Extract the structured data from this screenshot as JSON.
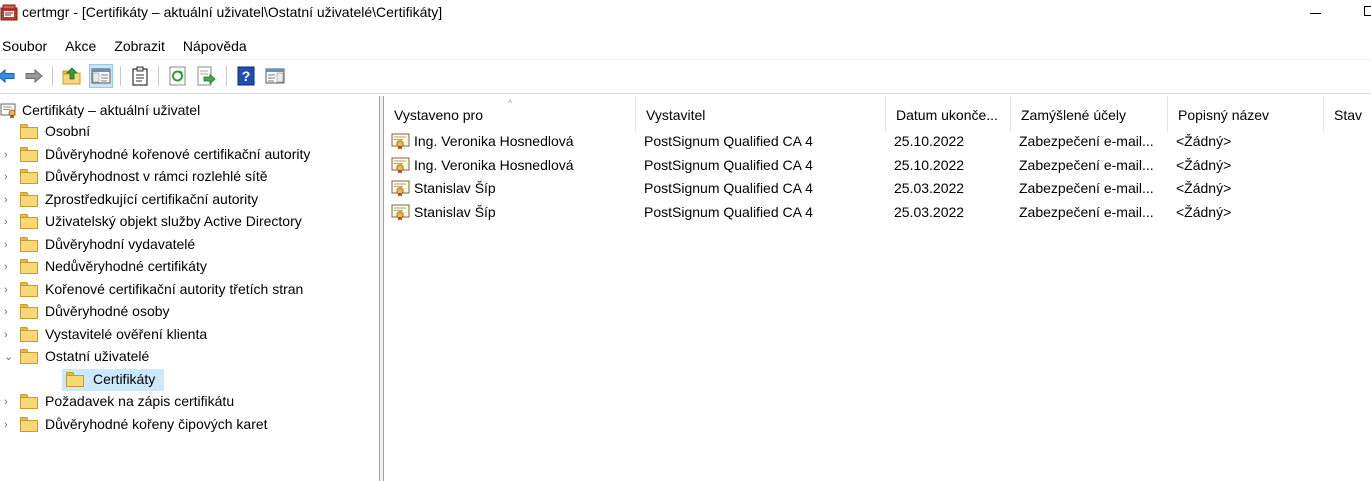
{
  "window": {
    "title": "certmgr - [Certifikáty – aktuální uživatel\\Ostatní uživatelé\\Certifikáty]"
  },
  "menu": [
    "Soubor",
    "Akce",
    "Zobrazit",
    "Nápověda"
  ],
  "toolbar": [
    {
      "name": "back-button",
      "icon": "arrow-left-icon"
    },
    {
      "name": "forward-button",
      "icon": "arrow-right-icon"
    },
    {
      "name": "up-one-level-button",
      "icon": "folder-up-icon"
    },
    {
      "name": "show-hide-console-tree-button",
      "icon": "console-tree-icon",
      "pressed": true
    },
    {
      "name": "clipboard-button",
      "icon": "clipboard-icon"
    },
    {
      "name": "refresh-button",
      "icon": "refresh-icon"
    },
    {
      "name": "export-list-button",
      "icon": "export-icon"
    },
    {
      "name": "help-button",
      "icon": "help-icon"
    },
    {
      "name": "properties-view-button",
      "icon": "properties-pane-icon"
    }
  ],
  "tree": {
    "root": "Certifikáty – aktuální uživatel",
    "items": [
      {
        "label": "Osobní",
        "chevron": "",
        "level": 0
      },
      {
        "label": "Důvěryhodné kořenové certifikační autority",
        "chevron": "›",
        "level": 0
      },
      {
        "label": "Důvěryhodnost v rámci rozlehlé sítě",
        "chevron": "›",
        "level": 0
      },
      {
        "label": "Zprostředkující certifikační autority",
        "chevron": "›",
        "level": 0
      },
      {
        "label": "Uživatelský objekt služby Active Directory",
        "chevron": "›",
        "level": 0
      },
      {
        "label": "Důvěryhodní vydavatelé",
        "chevron": "›",
        "level": 0
      },
      {
        "label": "Nedůvěryhodné certifikáty",
        "chevron": "›",
        "level": 0
      },
      {
        "label": "Kořenové certifikační autority třetích stran",
        "chevron": "›",
        "level": 0
      },
      {
        "label": "Důvěryhodné osoby",
        "chevron": "›",
        "level": 0
      },
      {
        "label": "Vystavitelé ověření klienta",
        "chevron": "›",
        "level": 0
      },
      {
        "label": "Ostatní uživatelé",
        "chevron": "⌄",
        "level": 0
      },
      {
        "label": "Certifikáty",
        "chevron": "",
        "level": 1,
        "selected": true
      },
      {
        "label": "Požadavek na zápis certifikátu",
        "chevron": "›",
        "level": 0
      },
      {
        "label": "Důvěryhodné kořeny čipových karet",
        "chevron": "›",
        "level": 0
      }
    ]
  },
  "list": {
    "sort_indicator": "^",
    "columns": [
      "Vystaveno pro",
      "Vystavitel",
      "Datum ukonče...",
      "Zamýšlené účely",
      "Popisný název",
      "Stav"
    ],
    "rows": [
      [
        "Ing. Veronika Hosnedlová",
        "PostSignum Qualified CA 4",
        "25.10.2022",
        "Zabezpečení e-mail...",
        "<Žádný>",
        ""
      ],
      [
        "Ing. Veronika Hosnedlová",
        "PostSignum Qualified CA 4",
        "25.10.2022",
        "Zabezpečení e-mail...",
        "<Žádný>",
        ""
      ],
      [
        "Stanislav Šíp",
        "PostSignum Qualified CA 4",
        "25.03.2022",
        "Zabezpečení e-mail...",
        "<Žádný>",
        ""
      ],
      [
        "Stanislav Šíp",
        "PostSignum Qualified CA 4",
        "25.03.2022",
        "Zabezpečení e-mail...",
        "<Žádný>",
        ""
      ]
    ]
  },
  "colors": {
    "selection": "#cce8ff",
    "pressed_button": "#cce4f7",
    "folder": "#f8d775"
  }
}
